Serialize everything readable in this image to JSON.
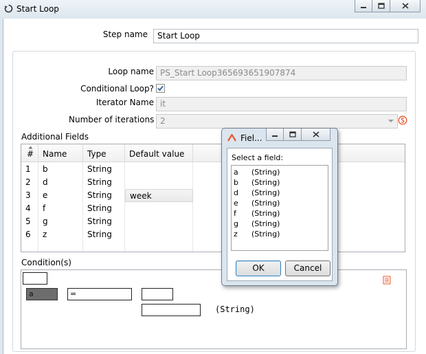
{
  "window": {
    "title": "Start Loop"
  },
  "step": {
    "label": "Step name",
    "value": "Start Loop"
  },
  "loop": {
    "loop_name_label": "Loop name",
    "loop_name_value": "PS_Start Loop365693651907874",
    "conditional_label": "Conditional Loop?",
    "conditional_checked": true,
    "iterator_label": "Iterator Name",
    "iterator_value": "it",
    "iterations_label": "Number of iterations",
    "iterations_value": "2"
  },
  "additional_fields": {
    "title": "Additional Fields",
    "columns": [
      "#",
      "Name",
      "Type",
      "Default value"
    ],
    "rows": [
      {
        "num": "1",
        "name": "b",
        "type": "String",
        "default": ""
      },
      {
        "num": "2",
        "name": "d",
        "type": "String",
        "default": ""
      },
      {
        "num": "3",
        "name": "e",
        "type": "String",
        "default": "week"
      },
      {
        "num": "4",
        "name": "f",
        "type": "String",
        "default": ""
      },
      {
        "num": "5",
        "name": "g",
        "type": "String",
        "default": ""
      },
      {
        "num": "6",
        "name": "z",
        "type": "String",
        "default": ""
      }
    ]
  },
  "conditions": {
    "title": "Condition(s)",
    "field": "a",
    "operator": "=",
    "type_text": "(String)"
  },
  "popup": {
    "title": "Fiel...",
    "prompt": "Select a field:",
    "fields": [
      {
        "name": "a",
        "type": "(String)"
      },
      {
        "name": "b",
        "type": "(String)"
      },
      {
        "name": "d",
        "type": "(String)"
      },
      {
        "name": "e",
        "type": "(String)"
      },
      {
        "name": "f",
        "type": "(String)"
      },
      {
        "name": "g",
        "type": "(String)"
      },
      {
        "name": "z",
        "type": "(String)"
      }
    ],
    "ok_label": "OK",
    "cancel_label": "Cancel"
  },
  "colors": {
    "titlebar": "#dde6ee",
    "accent_orange": "#e8572a",
    "selected_field_bg": "#6d6d6d"
  }
}
